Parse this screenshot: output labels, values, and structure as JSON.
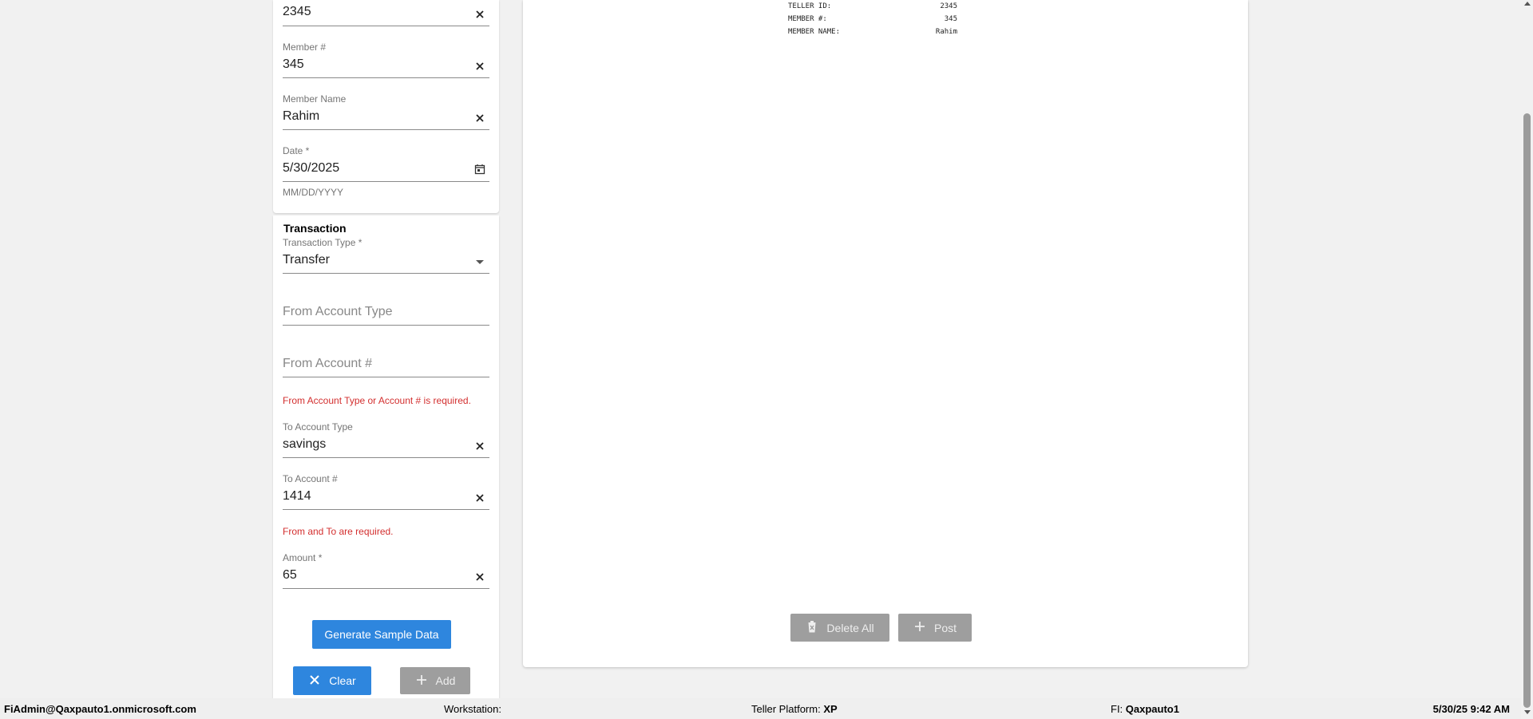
{
  "form": {
    "teller_id": {
      "value": "2345"
    },
    "member_no": {
      "label": "Member #",
      "value": "345"
    },
    "member_name": {
      "label": "Member Name",
      "value": "Rahim"
    },
    "date": {
      "label": "Date *",
      "value": "5/30/2025",
      "helper": "MM/DD/YYYY"
    },
    "transaction": {
      "title": "Transaction",
      "type": {
        "label": "Transaction Type *",
        "value": "Transfer"
      },
      "from_account_type": {
        "placeholder": "From Account Type"
      },
      "from_account_no": {
        "placeholder": "From Account #"
      },
      "from_error": "From Account Type or Account # is required.",
      "to_account_type": {
        "label": "To Account Type",
        "value": "savings"
      },
      "to_account_no": {
        "label": "To Account #",
        "value": "1414"
      },
      "to_error": "From and To are required.",
      "amount": {
        "label": "Amount *",
        "value": "65"
      }
    },
    "buttons": {
      "generate": "Generate Sample Data",
      "clear": "Clear",
      "add": "Add"
    }
  },
  "receipt": {
    "rows": [
      {
        "key": "TELLER ID:",
        "value": "2345"
      },
      {
        "key": "MEMBER #:",
        "value": "345"
      },
      {
        "key": "MEMBER NAME:",
        "value": "Rahim"
      }
    ],
    "buttons": {
      "delete_all": "Delete All",
      "post": "Post"
    }
  },
  "statusbar": {
    "user": "FiAdmin@Qaxpauto1.onmicrosoft.com",
    "workstation_label": "Workstation:",
    "workstation_value": "",
    "platform_label": "Teller Platform:",
    "platform_value": "XP",
    "fi_label": "FI:",
    "fi_value": "Qaxpauto1",
    "datetime": "5/30/25 9:42 AM"
  },
  "colors": {
    "primary": "#2e86de",
    "error": "#d32f2f",
    "disabled": "#9e9e9e"
  }
}
